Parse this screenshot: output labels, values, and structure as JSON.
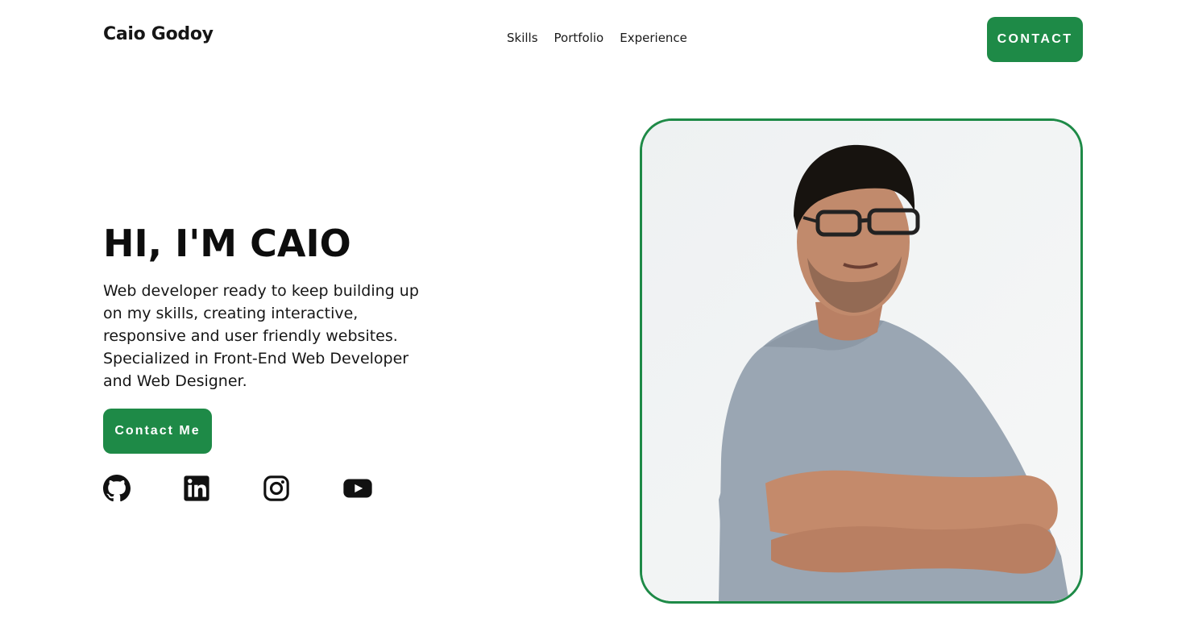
{
  "header": {
    "brand": "Caio Godoy",
    "nav": [
      "Skills",
      "Portfolio",
      "Experience"
    ],
    "contact_label": "CONTACT"
  },
  "hero": {
    "title": "HI, I'M CAIO",
    "description": "Web developer ready to keep building up on my skills, creating interactive, responsive and user friendly websites. Specialized in Front-End Web Developer and Web Designer.",
    "cta_label": "Contact Me"
  },
  "socials": [
    {
      "icon": "github-icon"
    },
    {
      "icon": "linkedin-icon"
    },
    {
      "icon": "instagram-icon"
    },
    {
      "icon": "youtube-icon"
    }
  ],
  "colors": {
    "accent": "#1e8a47",
    "text": "#111111",
    "background": "#ffffff"
  }
}
